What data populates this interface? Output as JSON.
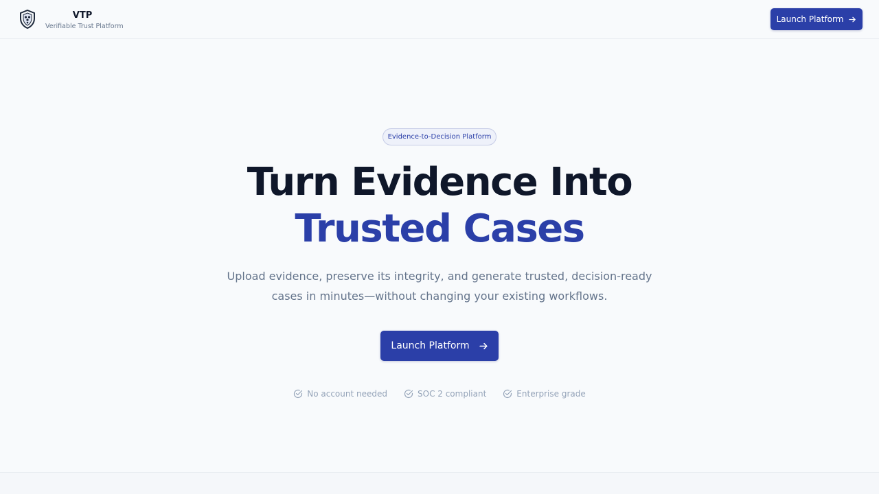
{
  "header": {
    "brand_name": "VTP",
    "brand_subtitle": "Verifiable Trust Platform",
    "launch_label": "Launch Platform"
  },
  "hero": {
    "badge": "Evidence-to-Decision Platform",
    "title_line1": "Turn Evidence Into",
    "title_line2": "Trusted Cases",
    "subtitle": "Upload evidence, preserve its integrity, and generate trusted, decision-ready cases in minutes—without changing your existing workflows.",
    "cta_label": "Launch Platform"
  },
  "features": [
    {
      "label": "No account needed"
    },
    {
      "label": "SOC 2 compliant"
    },
    {
      "label": "Enterprise grade"
    }
  ],
  "icons": {
    "logo": "shield-icon",
    "arrow": "arrow-right-icon",
    "check": "circle-check-icon"
  },
  "colors": {
    "accent": "#2b3fa8",
    "text_dark": "#0f172a",
    "text_muted": "#64748b",
    "background": "#f8fafc"
  }
}
